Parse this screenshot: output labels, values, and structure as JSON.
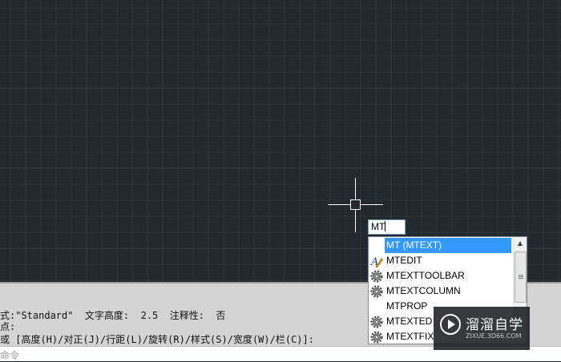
{
  "dynamic_input": {
    "value": "MT"
  },
  "autocomplete": {
    "items": [
      {
        "label": "MT (MTEXT)",
        "icon": "none",
        "selected": true
      },
      {
        "label": "MTEDIT",
        "icon": "text-edit-icon",
        "selected": false
      },
      {
        "label": "MTEXTTOOLBAR",
        "icon": "gear-icon",
        "selected": false
      },
      {
        "label": "MTEXTCOLUMN",
        "icon": "gear-icon",
        "selected": false
      },
      {
        "label": "MTPROP",
        "icon": "none",
        "selected": false
      },
      {
        "label": "MTEXTED",
        "icon": "gear-icon",
        "selected": false
      },
      {
        "label": "MTEXTFIX",
        "icon": "gear-icon",
        "selected": false
      }
    ],
    "scroll_up_glyph": "▲"
  },
  "command_history": {
    "lines": [
      "式:\"Standard\"  文字高度:  2.5  注释性:  否",
      "点:",
      "或 [高度(H)/对正(J)/行距(L)/旋转(R)/样式(S)/宽度(W)/栏(C)]:"
    ]
  },
  "command_prompt": {
    "text": "命令"
  },
  "watermark": {
    "title": "溜溜自学",
    "subtitle": "ZIXUE.3D66.COM"
  },
  "colors": {
    "canvas": "#212830",
    "selection": "#3399ff",
    "command_bg": "#d4d4d4"
  }
}
